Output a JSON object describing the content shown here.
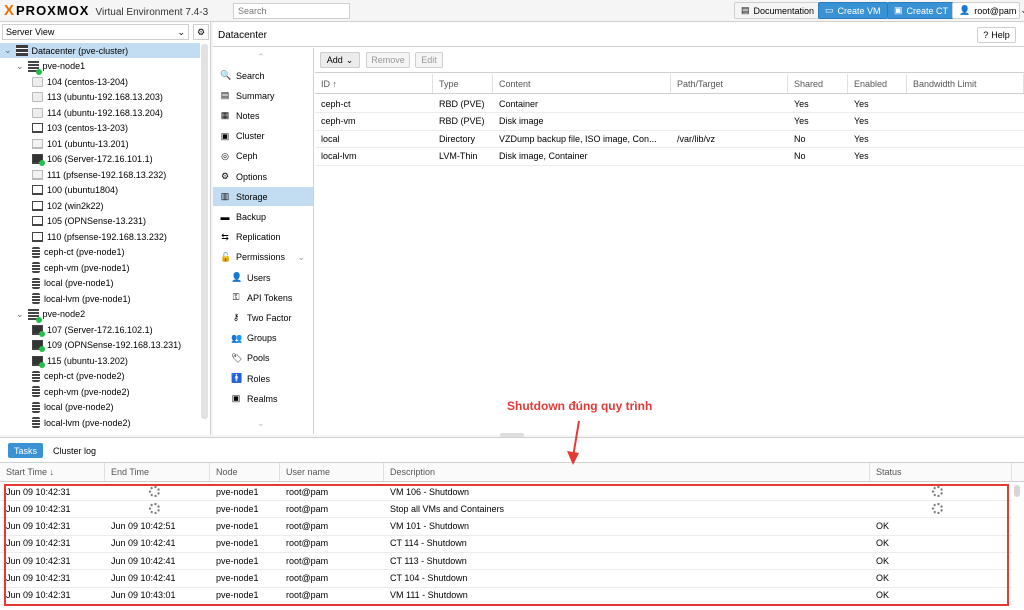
{
  "topbar": {
    "logo_x": "X",
    "logo_text": "PROXMOX",
    "product": "Virtual Environment 7.4-3",
    "search_placeholder": "Search",
    "documentation": "Documentation",
    "create_vm": "Create VM",
    "create_ct": "Create CT",
    "user": "root@pam"
  },
  "left": {
    "view_selector": "Server View",
    "tree": [
      {
        "label": "Datacenter (pve-cluster)",
        "icon": "server-stack-icon"
      },
      {
        "label": "pve-node1",
        "icon": "node-online-icon"
      },
      {
        "label": "104 (centos-13-204)",
        "icon": "container-icon"
      },
      {
        "label": "113 (ubuntu-192.168.13.203)",
        "icon": "container-icon"
      },
      {
        "label": "114 (ubuntu-192.168.13.204)",
        "icon": "container-icon"
      },
      {
        "label": "103 (centos-13-203)",
        "icon": "vm-icon"
      },
      {
        "label": "101 (ubuntu-13.201)",
        "icon": "template-icon"
      },
      {
        "label": "106 (Server-172.16.101.1)",
        "icon": "vm-running-icon"
      },
      {
        "label": "111 (pfsense-192.168.13.232)",
        "icon": "template-icon"
      },
      {
        "label": "100 (ubuntu1804)",
        "icon": "vm-icon"
      },
      {
        "label": "102 (win2k22)",
        "icon": "vm-icon"
      },
      {
        "label": "105 (OPNSense-13.231)",
        "icon": "vm-icon"
      },
      {
        "label": "110 (pfsense-192.168.13.232)",
        "icon": "vm-icon"
      },
      {
        "label": "ceph-ct (pve-node1)",
        "icon": "storage-icon"
      },
      {
        "label": "ceph-vm (pve-node1)",
        "icon": "storage-icon"
      },
      {
        "label": "local (pve-node1)",
        "icon": "storage-icon"
      },
      {
        "label": "local-lvm (pve-node1)",
        "icon": "storage-icon"
      },
      {
        "label": "pve-node2",
        "icon": "node-online-icon"
      },
      {
        "label": "107 (Server-172.16.102.1)",
        "icon": "vm-running-icon"
      },
      {
        "label": "109 (OPNSense-192.168.13.231)",
        "icon": "vm-running-icon"
      },
      {
        "label": "115 (ubuntu-13.202)",
        "icon": "vm-running-icon"
      },
      {
        "label": "ceph-ct (pve-node2)",
        "icon": "storage-icon"
      },
      {
        "label": "ceph-vm (pve-node2)",
        "icon": "storage-icon"
      },
      {
        "label": "local (pve-node2)",
        "icon": "storage-icon"
      },
      {
        "label": "local-lvm (pve-node2)",
        "icon": "storage-icon"
      }
    ]
  },
  "content": {
    "title": "Datacenter",
    "help": "Help",
    "menu": [
      {
        "label": "Search",
        "icon": "search-icon",
        "glyph": "🔍"
      },
      {
        "label": "Summary",
        "icon": "book-icon",
        "glyph": "▤"
      },
      {
        "label": "Notes",
        "icon": "notes-icon",
        "glyph": "▦"
      },
      {
        "label": "Cluster",
        "icon": "cluster-icon",
        "glyph": "▣"
      },
      {
        "label": "Ceph",
        "icon": "ceph-icon",
        "glyph": "◎"
      },
      {
        "label": "Options",
        "icon": "gear-icon",
        "glyph": "⚙"
      },
      {
        "label": "Storage",
        "icon": "database-icon",
        "glyph": "▥"
      },
      {
        "label": "Backup",
        "icon": "backup-icon",
        "glyph": "▬"
      },
      {
        "label": "Replication",
        "icon": "replication-icon",
        "glyph": "⇆"
      },
      {
        "label": "Permissions",
        "icon": "unlock-icon",
        "glyph": "🔓"
      },
      {
        "label": "Users",
        "icon": "user-icon",
        "glyph": "👤"
      },
      {
        "label": "API Tokens",
        "icon": "key-icon",
        "glyph": "⚿"
      },
      {
        "label": "Two Factor",
        "icon": "two-factor-key-icon",
        "glyph": "⚷"
      },
      {
        "label": "Groups",
        "icon": "users-icon",
        "glyph": "👥"
      },
      {
        "label": "Pools",
        "icon": "tags-icon",
        "glyph": "🏷"
      },
      {
        "label": "Roles",
        "icon": "male-icon",
        "glyph": "🚹"
      },
      {
        "label": "Realms",
        "icon": "address-book-icon",
        "glyph": "▣"
      }
    ],
    "toolbar": {
      "add": "Add",
      "remove": "Remove",
      "edit": "Edit"
    },
    "columns": [
      "ID ↑",
      "Type",
      "Content",
      "Path/Target",
      "Shared",
      "Enabled",
      "Bandwidth Limit"
    ],
    "rows": [
      [
        "ceph-ct",
        "RBD (PVE)",
        "Container",
        "",
        "Yes",
        "Yes",
        ""
      ],
      [
        "ceph-vm",
        "RBD (PVE)",
        "Disk image",
        "",
        "Yes",
        "Yes",
        ""
      ],
      [
        "local",
        "Directory",
        "VZDump backup file, ISO image, Con...",
        "/var/lib/vz",
        "No",
        "Yes",
        ""
      ],
      [
        "local-lvm",
        "LVM-Thin",
        "Disk image, Container",
        "",
        "No",
        "Yes",
        ""
      ]
    ]
  },
  "annotation": "Shutdown đúng quy trình",
  "tasks": {
    "tab_tasks": "Tasks",
    "tab_cluster_log": "Cluster log",
    "columns": [
      "Start Time ↓",
      "End Time",
      "Node",
      "User name",
      "Description",
      "Status"
    ],
    "rows": [
      [
        "Jun 09 10:42:31",
        "",
        "pve-node1",
        "root@pam",
        "VM 106 - Shutdown",
        ""
      ],
      [
        "Jun 09 10:42:31",
        "",
        "pve-node1",
        "root@pam",
        "Stop all VMs and Containers",
        ""
      ],
      [
        "Jun 09 10:42:31",
        "Jun 09 10:42:51",
        "pve-node1",
        "root@pam",
        "VM 101 - Shutdown",
        "OK"
      ],
      [
        "Jun 09 10:42:31",
        "Jun 09 10:42:41",
        "pve-node1",
        "root@pam",
        "CT 114 - Shutdown",
        "OK"
      ],
      [
        "Jun 09 10:42:31",
        "Jun 09 10:42:41",
        "pve-node1",
        "root@pam",
        "CT 113 - Shutdown",
        "OK"
      ],
      [
        "Jun 09 10:42:31",
        "Jun 09 10:42:41",
        "pve-node1",
        "root@pam",
        "CT 104 - Shutdown",
        "OK"
      ],
      [
        "Jun 09 10:42:31",
        "Jun 09 10:43:01",
        "pve-node1",
        "root@pam",
        "VM 111 - Shutdown",
        "OK"
      ]
    ]
  },
  "colors": {
    "accent": "#3892d3",
    "logo": "#e57000",
    "selection": "#c2ddf2",
    "highlight": "#e53935"
  }
}
